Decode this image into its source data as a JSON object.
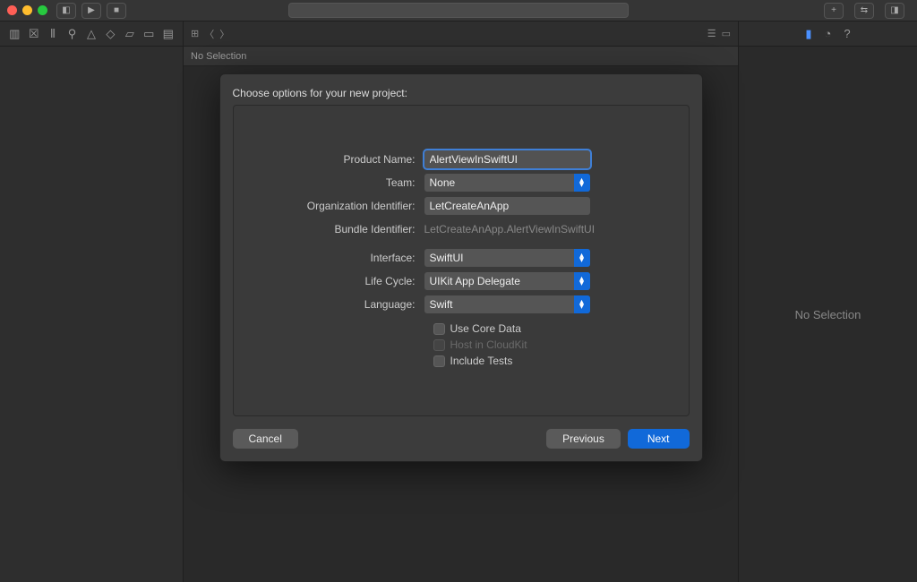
{
  "inspector": {
    "empty_text": "No Selection"
  },
  "editor_bar": {
    "no_selection": "No Selection"
  },
  "sheet": {
    "title": "Choose options for your new project:",
    "labels": {
      "product_name": "Product Name:",
      "team": "Team:",
      "org_id": "Organization Identifier:",
      "bundle_id": "Bundle Identifier:",
      "interface": "Interface:",
      "life_cycle": "Life Cycle:",
      "language": "Language:"
    },
    "values": {
      "product_name": "AlertViewInSwiftUI",
      "team": "None",
      "org_id": "LetCreateAnApp",
      "bundle_id": "LetCreateAnApp.AlertViewInSwiftUI",
      "interface": "SwiftUI",
      "life_cycle": "UIKit App Delegate",
      "language": "Swift"
    },
    "checks": {
      "core_data": "Use Core Data",
      "cloudkit": "Host in CloudKit",
      "tests": "Include Tests"
    },
    "buttons": {
      "cancel": "Cancel",
      "previous": "Previous",
      "next": "Next"
    }
  }
}
